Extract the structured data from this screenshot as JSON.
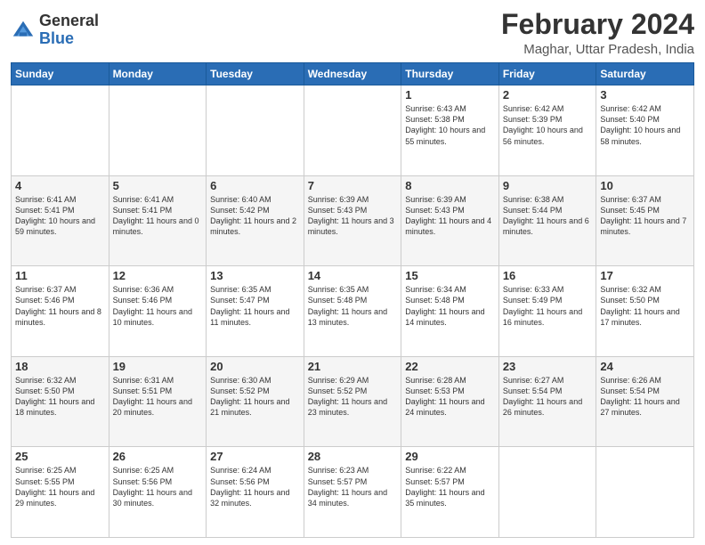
{
  "header": {
    "logo": {
      "general": "General",
      "blue": "Blue"
    },
    "title": "February 2024",
    "location": "Maghar, Uttar Pradesh, India"
  },
  "weekdays": [
    "Sunday",
    "Monday",
    "Tuesday",
    "Wednesday",
    "Thursday",
    "Friday",
    "Saturday"
  ],
  "weeks": [
    [
      {
        "day": "",
        "info": ""
      },
      {
        "day": "",
        "info": ""
      },
      {
        "day": "",
        "info": ""
      },
      {
        "day": "",
        "info": ""
      },
      {
        "day": "1",
        "info": "Sunrise: 6:43 AM\nSunset: 5:38 PM\nDaylight: 10 hours and 55 minutes."
      },
      {
        "day": "2",
        "info": "Sunrise: 6:42 AM\nSunset: 5:39 PM\nDaylight: 10 hours and 56 minutes."
      },
      {
        "day": "3",
        "info": "Sunrise: 6:42 AM\nSunset: 5:40 PM\nDaylight: 10 hours and 58 minutes."
      }
    ],
    [
      {
        "day": "4",
        "info": "Sunrise: 6:41 AM\nSunset: 5:41 PM\nDaylight: 10 hours and 59 minutes."
      },
      {
        "day": "5",
        "info": "Sunrise: 6:41 AM\nSunset: 5:41 PM\nDaylight: 11 hours and 0 minutes."
      },
      {
        "day": "6",
        "info": "Sunrise: 6:40 AM\nSunset: 5:42 PM\nDaylight: 11 hours and 2 minutes."
      },
      {
        "day": "7",
        "info": "Sunrise: 6:39 AM\nSunset: 5:43 PM\nDaylight: 11 hours and 3 minutes."
      },
      {
        "day": "8",
        "info": "Sunrise: 6:39 AM\nSunset: 5:43 PM\nDaylight: 11 hours and 4 minutes."
      },
      {
        "day": "9",
        "info": "Sunrise: 6:38 AM\nSunset: 5:44 PM\nDaylight: 11 hours and 6 minutes."
      },
      {
        "day": "10",
        "info": "Sunrise: 6:37 AM\nSunset: 5:45 PM\nDaylight: 11 hours and 7 minutes."
      }
    ],
    [
      {
        "day": "11",
        "info": "Sunrise: 6:37 AM\nSunset: 5:46 PM\nDaylight: 11 hours and 8 minutes."
      },
      {
        "day": "12",
        "info": "Sunrise: 6:36 AM\nSunset: 5:46 PM\nDaylight: 11 hours and 10 minutes."
      },
      {
        "day": "13",
        "info": "Sunrise: 6:35 AM\nSunset: 5:47 PM\nDaylight: 11 hours and 11 minutes."
      },
      {
        "day": "14",
        "info": "Sunrise: 6:35 AM\nSunset: 5:48 PM\nDaylight: 11 hours and 13 minutes."
      },
      {
        "day": "15",
        "info": "Sunrise: 6:34 AM\nSunset: 5:48 PM\nDaylight: 11 hours and 14 minutes."
      },
      {
        "day": "16",
        "info": "Sunrise: 6:33 AM\nSunset: 5:49 PM\nDaylight: 11 hours and 16 minutes."
      },
      {
        "day": "17",
        "info": "Sunrise: 6:32 AM\nSunset: 5:50 PM\nDaylight: 11 hours and 17 minutes."
      }
    ],
    [
      {
        "day": "18",
        "info": "Sunrise: 6:32 AM\nSunset: 5:50 PM\nDaylight: 11 hours and 18 minutes."
      },
      {
        "day": "19",
        "info": "Sunrise: 6:31 AM\nSunset: 5:51 PM\nDaylight: 11 hours and 20 minutes."
      },
      {
        "day": "20",
        "info": "Sunrise: 6:30 AM\nSunset: 5:52 PM\nDaylight: 11 hours and 21 minutes."
      },
      {
        "day": "21",
        "info": "Sunrise: 6:29 AM\nSunset: 5:52 PM\nDaylight: 11 hours and 23 minutes."
      },
      {
        "day": "22",
        "info": "Sunrise: 6:28 AM\nSunset: 5:53 PM\nDaylight: 11 hours and 24 minutes."
      },
      {
        "day": "23",
        "info": "Sunrise: 6:27 AM\nSunset: 5:54 PM\nDaylight: 11 hours and 26 minutes."
      },
      {
        "day": "24",
        "info": "Sunrise: 6:26 AM\nSunset: 5:54 PM\nDaylight: 11 hours and 27 minutes."
      }
    ],
    [
      {
        "day": "25",
        "info": "Sunrise: 6:25 AM\nSunset: 5:55 PM\nDaylight: 11 hours and 29 minutes."
      },
      {
        "day": "26",
        "info": "Sunrise: 6:25 AM\nSunset: 5:56 PM\nDaylight: 11 hours and 30 minutes."
      },
      {
        "day": "27",
        "info": "Sunrise: 6:24 AM\nSunset: 5:56 PM\nDaylight: 11 hours and 32 minutes."
      },
      {
        "day": "28",
        "info": "Sunrise: 6:23 AM\nSunset: 5:57 PM\nDaylight: 11 hours and 34 minutes."
      },
      {
        "day": "29",
        "info": "Sunrise: 6:22 AM\nSunset: 5:57 PM\nDaylight: 11 hours and 35 minutes."
      },
      {
        "day": "",
        "info": ""
      },
      {
        "day": "",
        "info": ""
      }
    ]
  ]
}
